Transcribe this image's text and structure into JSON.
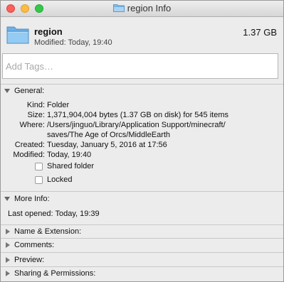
{
  "window": {
    "title": "region Info"
  },
  "header": {
    "name": "region",
    "modified": "Modified: Today, 19:40",
    "size": "1.37 GB",
    "icon": "folder-icon"
  },
  "tags": {
    "placeholder": "Add Tags…",
    "value": ""
  },
  "general": {
    "label": "General:",
    "expanded": true,
    "kind_key": "Kind:",
    "kind_val": "Folder",
    "size_key": "Size:",
    "size_val": "1,371,904,004 bytes (1.37 GB on disk) for 545 items",
    "where_key": "Where:",
    "where_val_1": "/Users/jinguo/Library/Application Support/minecraft/",
    "where_val_2": "saves/The Age of Orcs/MiddleEarth",
    "created_key": "Created:",
    "created_val": "Tuesday, January 5, 2016 at 17:56",
    "modified_key": "Modified:",
    "modified_val": "Today, 19:40",
    "shared_folder": "Shared folder",
    "locked": "Locked"
  },
  "more_info": {
    "label": "More Info:",
    "expanded": true,
    "last_opened": "Last opened: Today, 19:39"
  },
  "collapsed_sections": {
    "name_ext": "Name & Extension:",
    "comments": "Comments:",
    "preview": "Preview:",
    "sharing": "Sharing & Permissions:"
  },
  "colors": {
    "folder": "#7cb9e8",
    "close": "#fc605c",
    "minimize": "#fdbc40",
    "maximize": "#34c84a"
  }
}
